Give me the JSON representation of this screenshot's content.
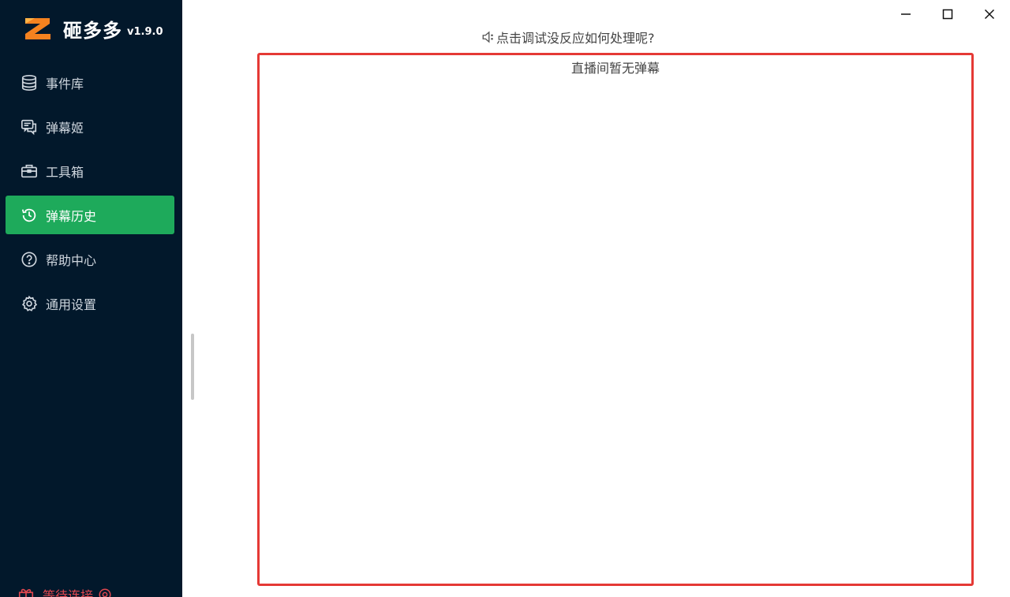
{
  "app": {
    "name": "砸多多",
    "version": "v1.9.0"
  },
  "sidebar": {
    "items": [
      {
        "label": "事件库",
        "icon": "database-icon",
        "active": false
      },
      {
        "label": "弹幕姬",
        "icon": "chat-icon",
        "active": false
      },
      {
        "label": "工具箱",
        "icon": "toolbox-icon",
        "active": false
      },
      {
        "label": "弹幕历史",
        "icon": "history-icon",
        "active": true
      },
      {
        "label": "帮助中心",
        "icon": "help-icon",
        "active": false
      },
      {
        "label": "通用设置",
        "icon": "gear-icon",
        "active": false
      }
    ],
    "status_text": "等待连接",
    "status_color": "#e0474f",
    "active_color": "#1eaa5b",
    "background": "#02182b"
  },
  "hint": {
    "text": "点击调试没反应如何处理呢?",
    "icon": "speaker-icon"
  },
  "panel": {
    "empty_text": "直播间暂无弹幕",
    "border_color": "#e53935"
  },
  "window_controls": {
    "icons": [
      "minimize-icon",
      "maximize-icon",
      "close-icon"
    ]
  }
}
